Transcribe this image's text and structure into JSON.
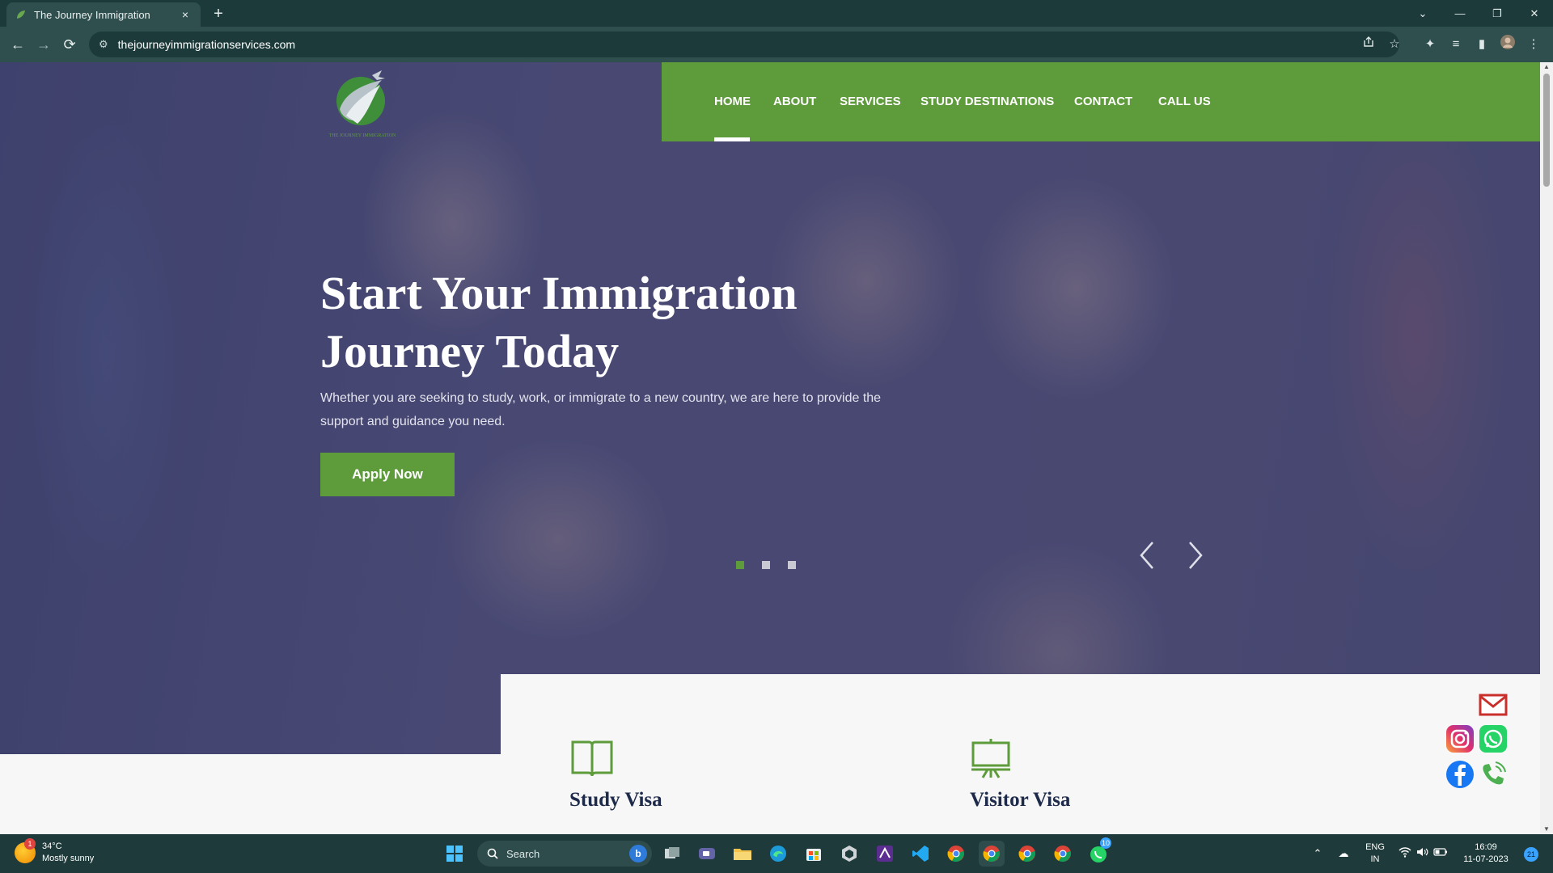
{
  "browser": {
    "tab_title": "The Journey Immigration",
    "tab_close": "×",
    "new_tab": "+",
    "url": "thejourneyimmigrationservices.com",
    "site_info": "⚙",
    "window_controls": {
      "dropdown": "⌄",
      "minimize": "—",
      "restore": "❐",
      "close": "✕"
    },
    "nav": {
      "back": "←",
      "forward": "→",
      "reload": "⟳"
    },
    "toolbar_icons": [
      "share-icon",
      "bookmark-star-icon",
      "extensions-icon",
      "media-icon",
      "side-panel-icon",
      "profile-icon",
      "menu-icon"
    ]
  },
  "site": {
    "nav": {
      "home": "HOME",
      "about": "ABOUT",
      "services": "SERVICES",
      "study_destinations": "STUDY DESTINATIONS",
      "contact": "CONTACT",
      "call_us": "CALL US",
      "active": "home"
    },
    "logo_text": "THE JOURNEY IMMIGRATION",
    "hero": {
      "title_line1": "Start Your Immigration",
      "title_line2": "Journey Today",
      "text": "Whether you are seeking to study, work, or immigrate to a new country, we are here to provide the support and guidance you need.",
      "button": "Apply Now",
      "slides": 3,
      "active_slide": 1
    },
    "services": [
      {
        "title": "Study Visa",
        "icon": "open-book-icon"
      },
      {
        "title": "Visitor Visa",
        "icon": "presentation-board-icon"
      }
    ],
    "floating_contacts": [
      "gmail-icon",
      "instagram-icon",
      "whatsapp-icon",
      "facebook-icon",
      "phone-icon"
    ]
  },
  "taskbar": {
    "weather_temp": "34°C",
    "weather_desc": "Mostly sunny",
    "weather_badge": "1",
    "search_label": "Search",
    "lang_top": "ENG",
    "lang_bottom": "IN",
    "time": "16:09",
    "date": "11-07-2023",
    "notification_count": "21",
    "whatsapp_badge": "10"
  },
  "colors": {
    "brand_green": "#5e9b3b",
    "chrome_dark": "#1d3a3b",
    "title_navy": "#1e2a4a"
  }
}
